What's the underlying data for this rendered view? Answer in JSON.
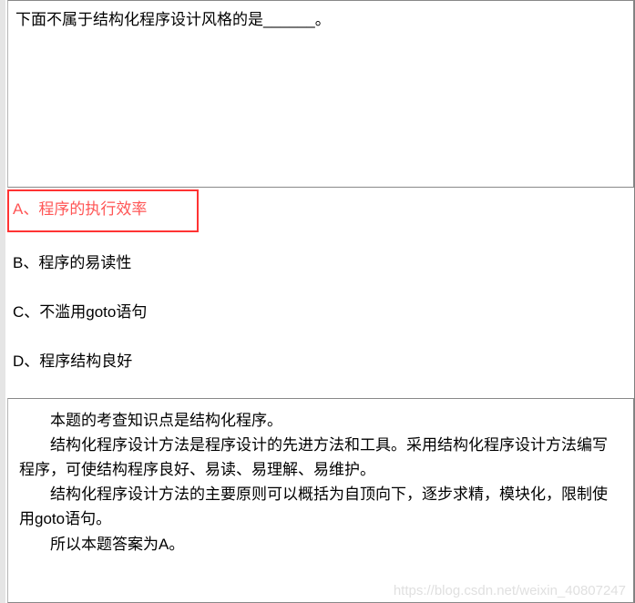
{
  "question": {
    "stem": "下面不属于结构化程序设计风格的是______。"
  },
  "options": {
    "a": "A、程序的执行效率",
    "b": "B、程序的易读性",
    "c": "C、不滥用goto语句",
    "d": "D、程序结构良好"
  },
  "explanation": {
    "line1": "本题的考查知识点是结构化程序。",
    "line2": "结构化程序设计方法是程序设计的先进方法和工具。采用结构化程序设计方法编写程序，可使结构程序良好、易读、易理解、易维护。",
    "line3": "结构化程序设计方法的主要原则可以概括为自顶向下，逐步求精，模块化，限制使用goto语句。",
    "line4": "所以本题答案为A。"
  },
  "watermark": "https://blog.csdn.net/weixin_40807247"
}
